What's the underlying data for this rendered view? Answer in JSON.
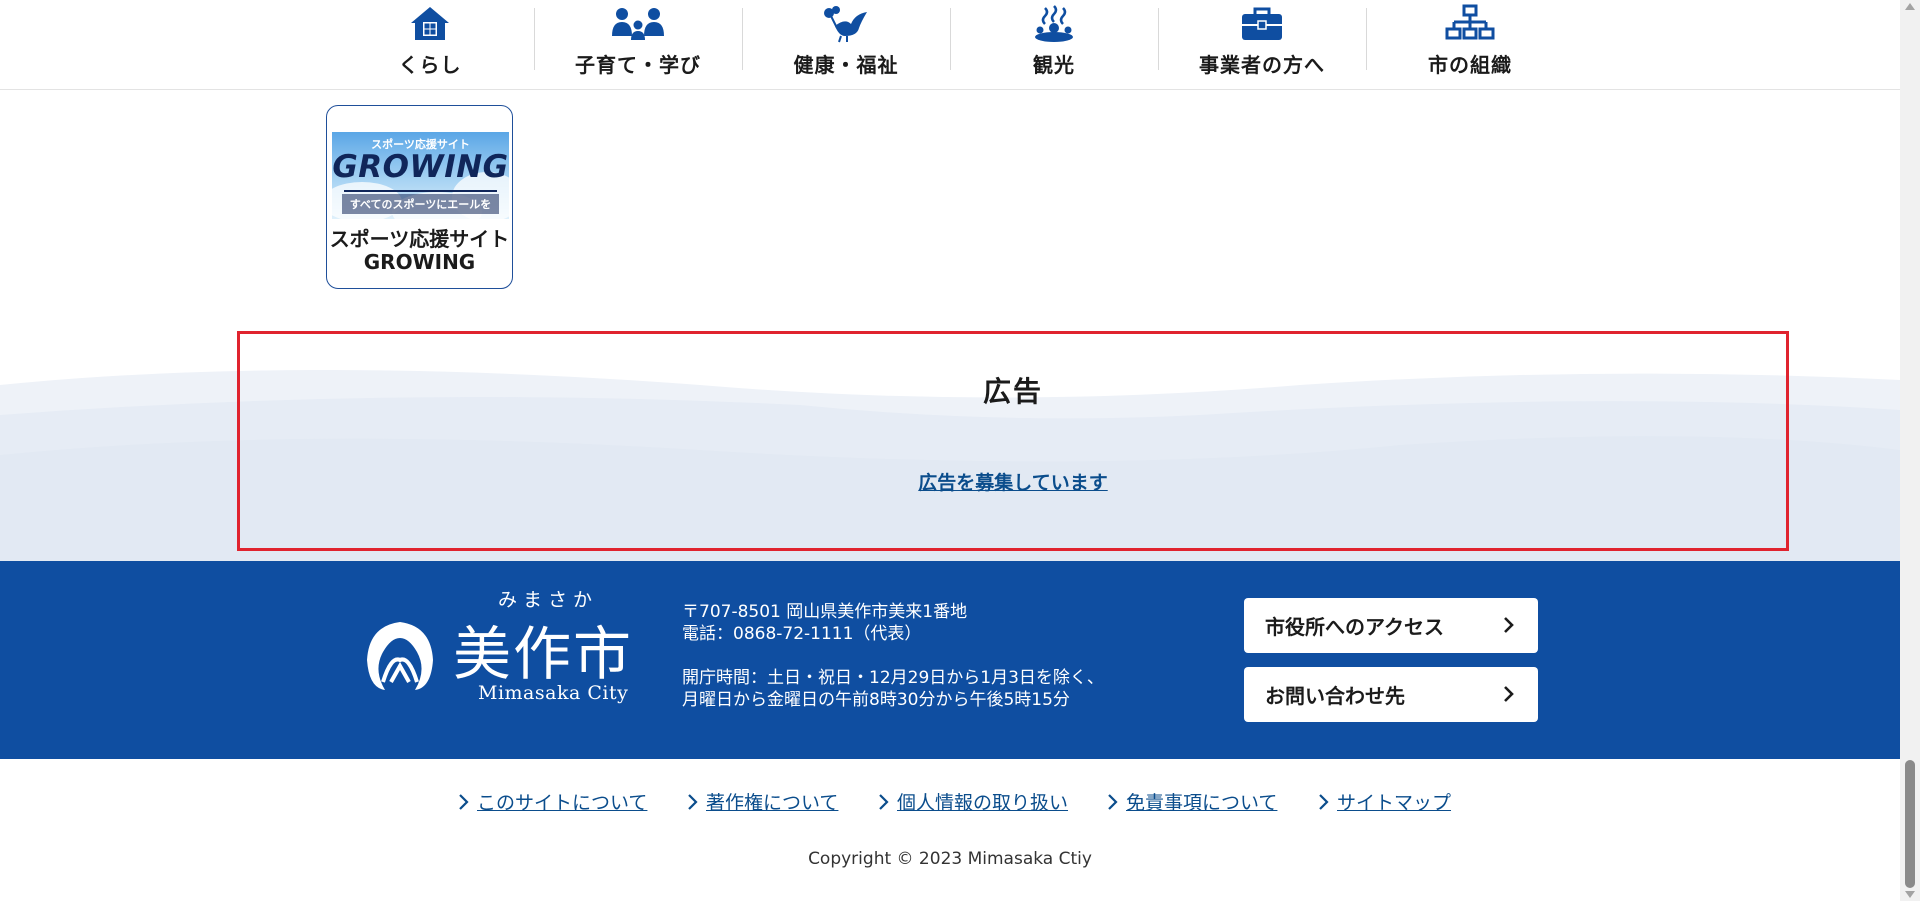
{
  "nav": {
    "items": [
      {
        "label": "くらし",
        "icon": "house-icon"
      },
      {
        "label": "子育て・学び",
        "icon": "family-icon"
      },
      {
        "label": "健康・福祉",
        "icon": "dove-icon"
      },
      {
        "label": "観光",
        "icon": "hot-spring-icon"
      },
      {
        "label": "事業者の方へ",
        "icon": "briefcase-icon"
      },
      {
        "label": "市の組織",
        "icon": "org-chart-icon"
      }
    ]
  },
  "banner": {
    "image_small_text": "スポーツ応援サイト",
    "image_big_text": "GROWING",
    "image_sub_text": "すべてのスポーツにエールを",
    "caption_line1": "スポーツ応援サイト",
    "caption_line2": "GROWING"
  },
  "ad": {
    "title": "広告",
    "link": "広告を募集しています"
  },
  "footer": {
    "logo_kana": "みまさか",
    "logo_kanji": "美作市",
    "logo_roman": "Mimasaka City",
    "address": "〒707-8501 岡山県美作市美来1番地",
    "phone": "電話：0868-72-1111（代表）",
    "hours_line1": "開庁時間：土日・祝日・12月29日から1月3日を除く、",
    "hours_line2": "月曜日から金曜日の午前8時30分から午後5時15分",
    "access_button": "市役所へのアクセス",
    "contact_button": "お問い合わせ先"
  },
  "links": [
    "このサイトについて",
    "著作権について",
    "個人情報の取り扱い",
    "免責事項について",
    "サイトマップ"
  ],
  "copyright": "Copyright © 2023 Mimasaka Ctiy",
  "colors": {
    "brand_blue": "#0f4ea1",
    "link_blue": "#0b4d8c",
    "highlight_red": "#e0232e"
  }
}
